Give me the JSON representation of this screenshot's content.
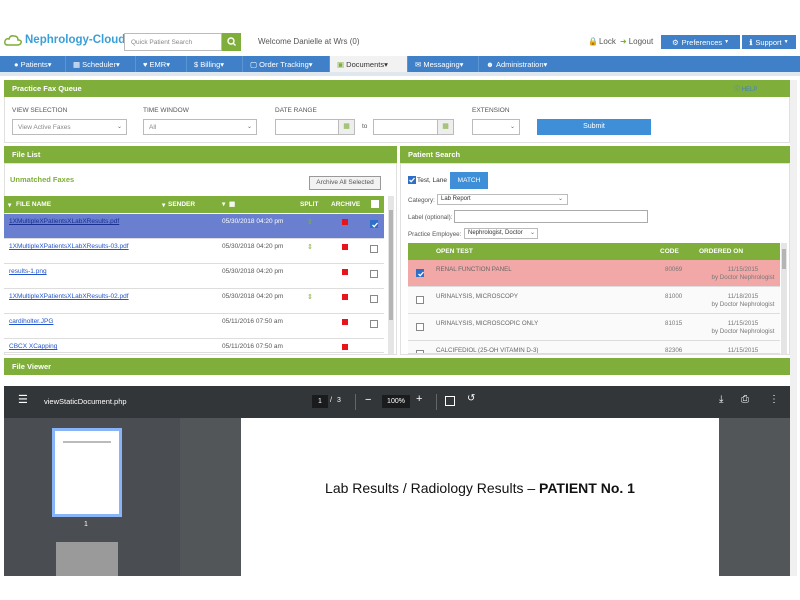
{
  "header": {
    "logo_text": "Nephrology-Cloud",
    "search_placeholder": "Quick Patient Search",
    "welcome": "Welcome Danielle at Wrs (0)",
    "lock": "Lock",
    "logout": "Logout",
    "preferences": "Preferences",
    "support": "Support"
  },
  "nav": {
    "items": [
      "Patients",
      "Scheduler",
      "EMR",
      "Billing",
      "Order Tracking",
      "Documents",
      "Messaging",
      "Administration"
    ],
    "active": "Documents"
  },
  "fax_queue": {
    "title": "Practice Fax Queue",
    "help": "HELP",
    "view_selection_label": "VIEW SELECTION",
    "view_selection_value": "View Active Faxes",
    "time_window_label": "TIME WINDOW",
    "time_window_value": "All",
    "date_range_label": "DATE RANGE",
    "date_to": "to",
    "extension_label": "EXTENSION",
    "submit": "Submit"
  },
  "file_list": {
    "title": "File List",
    "subtitle": "Unmatched Faxes",
    "archive_all": "Archive All Selected",
    "columns": {
      "file_name": "FILE NAME",
      "sender": "SENDER",
      "split": "SPLIT",
      "archive": "ARCHIVE"
    },
    "rows": [
      {
        "name": "1XMultipleXPatientsXLabXResults.pdf",
        "date": "05/30/2018 04:20 pm",
        "split": true,
        "checked": true,
        "selected": true
      },
      {
        "name": "1XMultipleXPatientsXLabXResults-03.pdf",
        "date": "05/30/2018 04:20 pm",
        "split": true,
        "checked": false,
        "selected": false
      },
      {
        "name": "results-1.png",
        "date": "05/30/2018 04:20 pm",
        "split": false,
        "checked": false,
        "selected": false
      },
      {
        "name": "1XMultipleXPatientsXLabXResults-02.pdf",
        "date": "05/30/2018 04:20 pm",
        "split": true,
        "checked": false,
        "selected": false
      },
      {
        "name": "cardiholter.JPG",
        "date": "05/11/2016 07:50 am",
        "split": false,
        "checked": false,
        "selected": false
      },
      {
        "name": "CBCX XCapping",
        "date": "05/11/2016 07:50 am",
        "split": false,
        "checked": false,
        "selected": false
      }
    ]
  },
  "patient_search": {
    "title": "Patient Search",
    "patient_name": "Test, Lane",
    "match": "MATCH",
    "category_label": "Category:",
    "category_value": "Lab Report",
    "label_label": "Label (optional):",
    "practice_employee_label": "Practice Employee:",
    "practice_employee_value": "Nephrologist, Doctor",
    "columns": {
      "open_test": "OPEN TEST",
      "code": "CODE",
      "ordered_on": "ORDERED ON"
    },
    "rows": [
      {
        "test": "RENAL FUNCTION PANEL",
        "code": "80069",
        "date": "11/15/2015",
        "by": "by Doctor Nephrologist",
        "checked": true,
        "highlight": true
      },
      {
        "test": "URINALYSIS, MICROSCOPY",
        "code": "81000",
        "date": "11/18/2015",
        "by": "by Doctor Nephrologist",
        "checked": false,
        "highlight": false
      },
      {
        "test": "URINALYSIS, MICROSCOPIC ONLY",
        "code": "81015",
        "date": "11/15/2015",
        "by": "by Doctor Nephrologist",
        "checked": false,
        "highlight": false
      },
      {
        "test": "CALCIFEDIOL (25-OH VITAMIN D-3)",
        "code": "82306",
        "date": "11/15/2015",
        "by": "",
        "checked": false,
        "highlight": false
      }
    ]
  },
  "viewer": {
    "title": "File Viewer",
    "doc_name": "viewStaticDocument.php",
    "page_current": "1",
    "page_total": "3",
    "zoom": "100%",
    "thumb_label": "1",
    "page_heading": "Lab Results / Radiology Results – ",
    "page_heading_bold": "PATIENT No. 1"
  },
  "colors": {
    "green": "#7fae3a",
    "blue": "#3f80c8",
    "highlight": "#f3a8a8",
    "selected": "#6a7fd0",
    "archive": "#e8131b"
  }
}
